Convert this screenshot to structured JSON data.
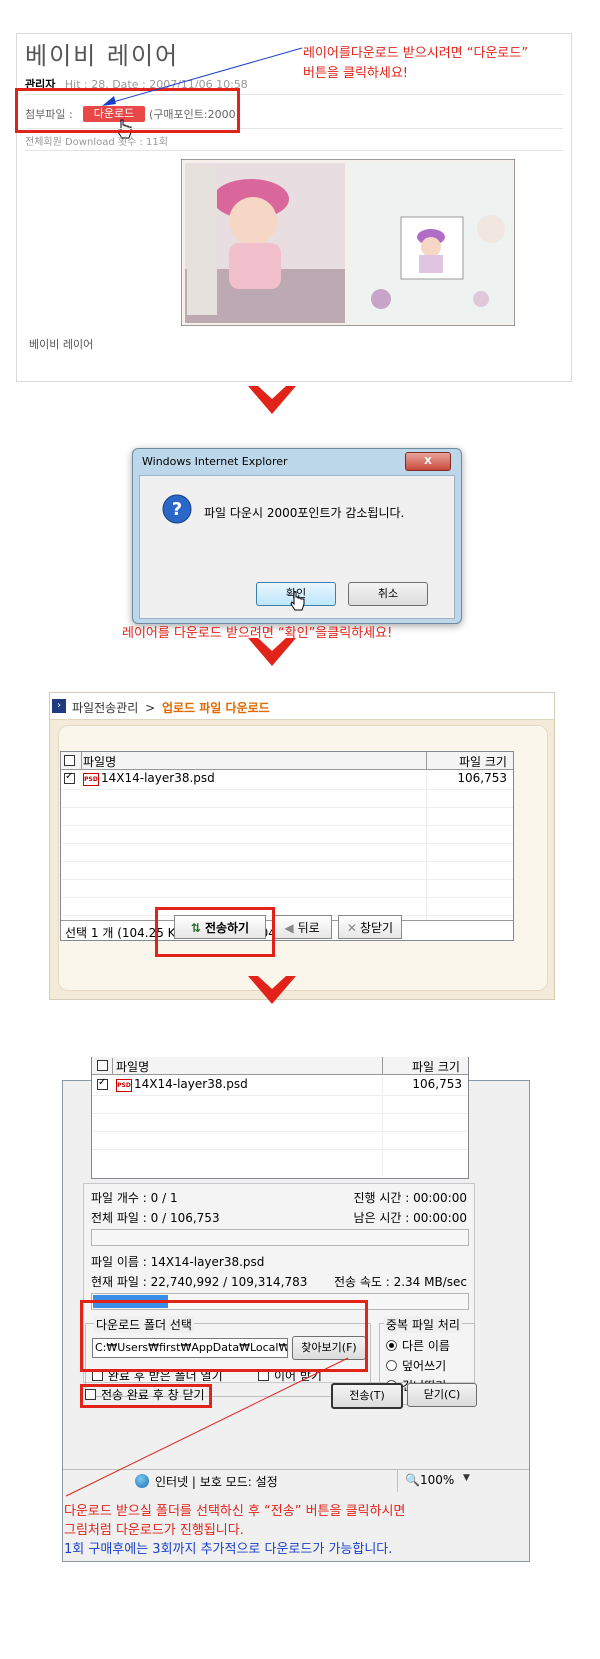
{
  "panel1": {
    "title": "베이비 레이어",
    "author_label": "관리자",
    "hit_date": "Hit : 28, Date : 2007/11/06 10:58",
    "attachment_label": "첨부파일 :",
    "download_button": "다운로드",
    "points": "(구매포인트:2000)",
    "download_count": "전체회원 Download 횟수 : 11회",
    "caption": "베이비 레이어",
    "callout_line1": "레이어를다운로드 받으시려면 “다운로드”",
    "callout_line2": "버튼을 클릭하세요!"
  },
  "dialog": {
    "title": "Windows Internet Explorer",
    "close": "X",
    "message": "파일 다운시 2000포인트가 감소됩니다.",
    "ok": "확인",
    "cancel": "취소",
    "instruction": "레이어를 다운로드 받으려면 “확인”을클릭하세요!"
  },
  "panel3": {
    "breadcrumb_root": "파일전송관리",
    "breadcrumb_sep": ">",
    "breadcrumb_current": "업로드 파일 다운로드",
    "col_filename": "파일명",
    "col_size": "파일 크기",
    "file_name": "14X14-layer38.psd",
    "file_size": "106,753",
    "psd_icon": "PSD",
    "summary": "선택 1 개 (104.25 KB), 전체 1 개 (104.25 KB)",
    "send_button": "전송하기",
    "back_button": "뒤로",
    "close_button": "창닫기"
  },
  "panel4": {
    "col_filename": "파일명",
    "col_size": "파일 크기",
    "file_name": "14X14-layer38.psd",
    "file_size": "106,753",
    "file_count": "파일 개수 : 0 / 1",
    "elapsed": "진행 시간 : 00:00:00",
    "total_file": "전체 파일 : 0 / 106,753",
    "remaining": "남은 시간 : 00:00:00",
    "file_name_line": "파일 이름 : 14X14-layer38.psd",
    "current_file": "현재 파일 : 22,740,992 / 109,314,783",
    "speed": "전송 속도 : 2.34 MB/sec",
    "current_progress": 0.2,
    "folder_group": "다운로드 폴더 선택",
    "folder_path": "C:₩Users₩first₩AppData₩Local₩Te",
    "browse_button": "찾아보기(F)",
    "open_folder": "완료 후 받은 폴더 열기",
    "resume": "이어 받기",
    "dup_group": "중복 파일 처리",
    "dup_rename": "다른 이름",
    "dup_overwrite": "덮어쓰기",
    "dup_skip": "건너뛰기",
    "close_after": "전송 완료 후 창 닫기",
    "send_button": "전송(T)",
    "close_button": "닫기(C)",
    "status_zone": "인터넷 | 보호 모드: 설정",
    "zoom": "100%",
    "progress_color": "#3b8ee8"
  },
  "footer": {
    "line1": "다운로드 받으실 폴더를 선택하신 후 “전송” 버튼을 클릭하시면",
    "line2": "그림처럼 다운로드가 진행됩니다.",
    "line3": "1회 구매후에는 3회까지 추가적으로 다운로드가 가능합니다."
  },
  "colors": {
    "accent_red": "#e2231a",
    "link_blue": "#1a3fcc"
  }
}
